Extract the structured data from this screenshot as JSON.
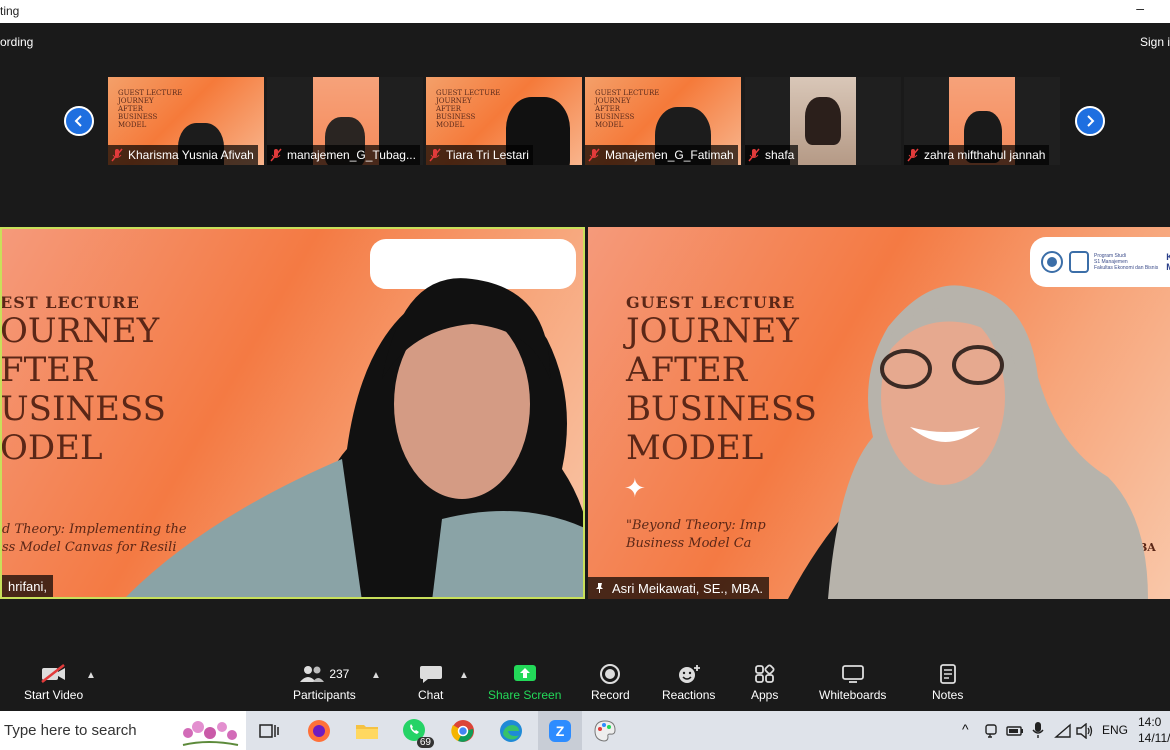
{
  "window": {
    "title_fragment": "ting",
    "minimize_glyph": "–"
  },
  "recording": {
    "label": "ording",
    "sign_in": "Sign i"
  },
  "gallery": {
    "participants": [
      {
        "name": "Kharisma Yusnia Afivah"
      },
      {
        "name": "manajemen_G_Tubag..."
      },
      {
        "name": "Tiara Tri Lestari"
      },
      {
        "name": "Manajemen_G_Fatimah"
      },
      {
        "name": "shafa"
      },
      {
        "name": "zahra mifthahul jannah"
      }
    ],
    "slide_mini_text": "GUEST LECTURE\nJOURNEY\nAFTER\nBUSINESS\nMODEL"
  },
  "left_tile": {
    "speaker_name": "hrifani,",
    "slide": {
      "heading": "EST LECTURE",
      "line1": "OURNEY",
      "line2": "FTER",
      "line3": "USINESS",
      "line4": "ODEL",
      "subtitle1": "d Theory: Implementing the",
      "subtitle2": "ss Model Canvas for Resili"
    }
  },
  "right_tile": {
    "speaker_name": "Asri Meikawati, SE., MBA.",
    "slide": {
      "heading": "GUEST LECTURE",
      "line1": "JOURNEY",
      "line2": "AFTER",
      "line3": "BUSINESS",
      "line4": "MODEL",
      "subtitle1": "\"Beyond Theory: Imp",
      "subtitle2": "Business Model Ca",
      "logo_text1": "Program Studi",
      "logo_text2": "S1 Manajemen",
      "logo_text3": "Fakultas Ekonomi dan Bisnis",
      "logo_ko": "Ko",
      "logo_mi": "Mi",
      "side_text": "BA"
    }
  },
  "controls": {
    "start_video": "Start Video",
    "participants": "Participants",
    "participant_count": "237",
    "chat": "Chat",
    "share_screen": "Share Screen",
    "record": "Record",
    "reactions": "Reactions",
    "apps": "Apps",
    "whiteboards": "Whiteboards",
    "notes": "Notes",
    "share_color": "#23d959"
  },
  "taskbar": {
    "search_placeholder": "Type here to search",
    "whatsapp_badge": "69",
    "lang": "ENG",
    "time": "14:0",
    "date": "14/11/"
  }
}
